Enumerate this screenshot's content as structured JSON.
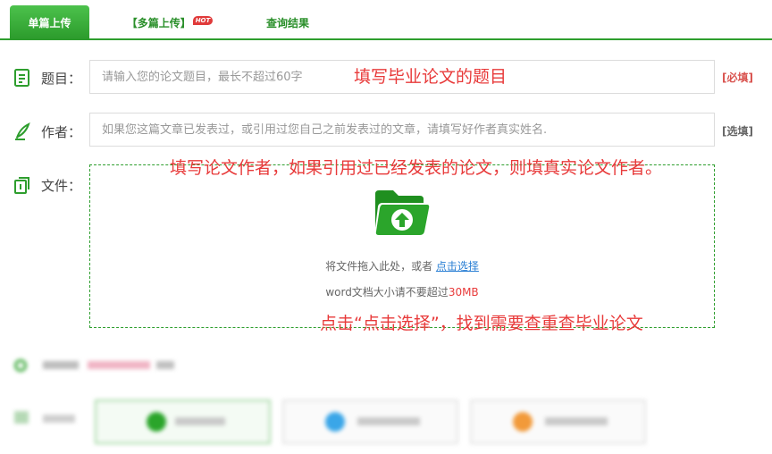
{
  "tabs": [
    {
      "label": "单篇上传",
      "active": true
    },
    {
      "label": "【多篇上传】",
      "badge": "HOT"
    },
    {
      "label": "查询结果"
    }
  ],
  "form": {
    "title": {
      "label": "题目：",
      "placeholder": "请输入您的论文题目，最长不超过60字",
      "tag": "[必填]",
      "note": "填写毕业论文的题目"
    },
    "author": {
      "label": "作者：",
      "placeholder": "如果您这篇文章已发表过，或引用过您自己之前发表过的文章，请填写好作者真实姓名.",
      "tag": "[选填]",
      "note": "填写论文作者，如果引用过已经发表的论文，则填真实论文作者。"
    },
    "file": {
      "label": "文件：",
      "drop_text": "将文件拖入此处，或者",
      "drop_link": "点击选择",
      "size_prefix": "word文档大小请不要超过",
      "size_limit": "30MB",
      "note": "点击“点击选择”，找到需要查重查毕业论文"
    }
  },
  "colors": {
    "accent": "#2e9e2e",
    "annotation": "#e83a3a",
    "link": "#2a7fd4"
  }
}
